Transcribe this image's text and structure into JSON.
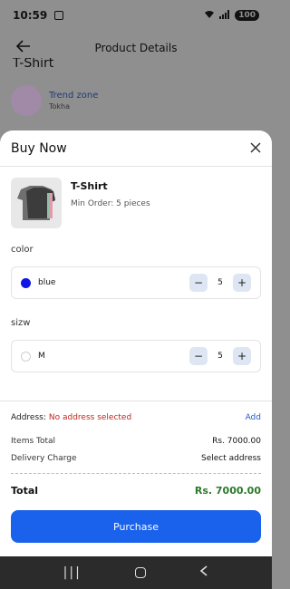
{
  "status_bar": {
    "time": "10:59",
    "battery": "100"
  },
  "header": {
    "title": "Product Details",
    "partial_product_title": "T-Shirt"
  },
  "seller": {
    "name": "Trend zone",
    "location": "Tokha"
  },
  "sheet": {
    "title": "Buy Now",
    "product": {
      "name": "T-Shirt",
      "min_order": "Min Order: 5 pieces"
    },
    "color_label": "color",
    "color_option": {
      "label": "blue",
      "quantity": "5",
      "selected": true
    },
    "size_label": "sizw",
    "size_option": {
      "label": "M",
      "quantity": "5",
      "selected": false
    },
    "address_label": "Address:",
    "address_value": "No address selected",
    "address_add": "Add",
    "items_total_label": "Items Total",
    "items_total_value": "Rs. 7000.00",
    "delivery_label": "Delivery Charge",
    "delivery_value": "Select address",
    "total_label": "Total",
    "total_value": "Rs. 7000.00",
    "purchase_label": "Purchase"
  },
  "colors": {
    "accent": "#1a62ec",
    "selected_color": "#1016e6",
    "error": "#c2261d",
    "total": "#2a7a2a"
  },
  "icons": [
    "back-arrow-icon",
    "close-icon",
    "minus-icon",
    "plus-icon",
    "nav-recent-icon",
    "nav-home-icon",
    "nav-back-icon"
  ]
}
